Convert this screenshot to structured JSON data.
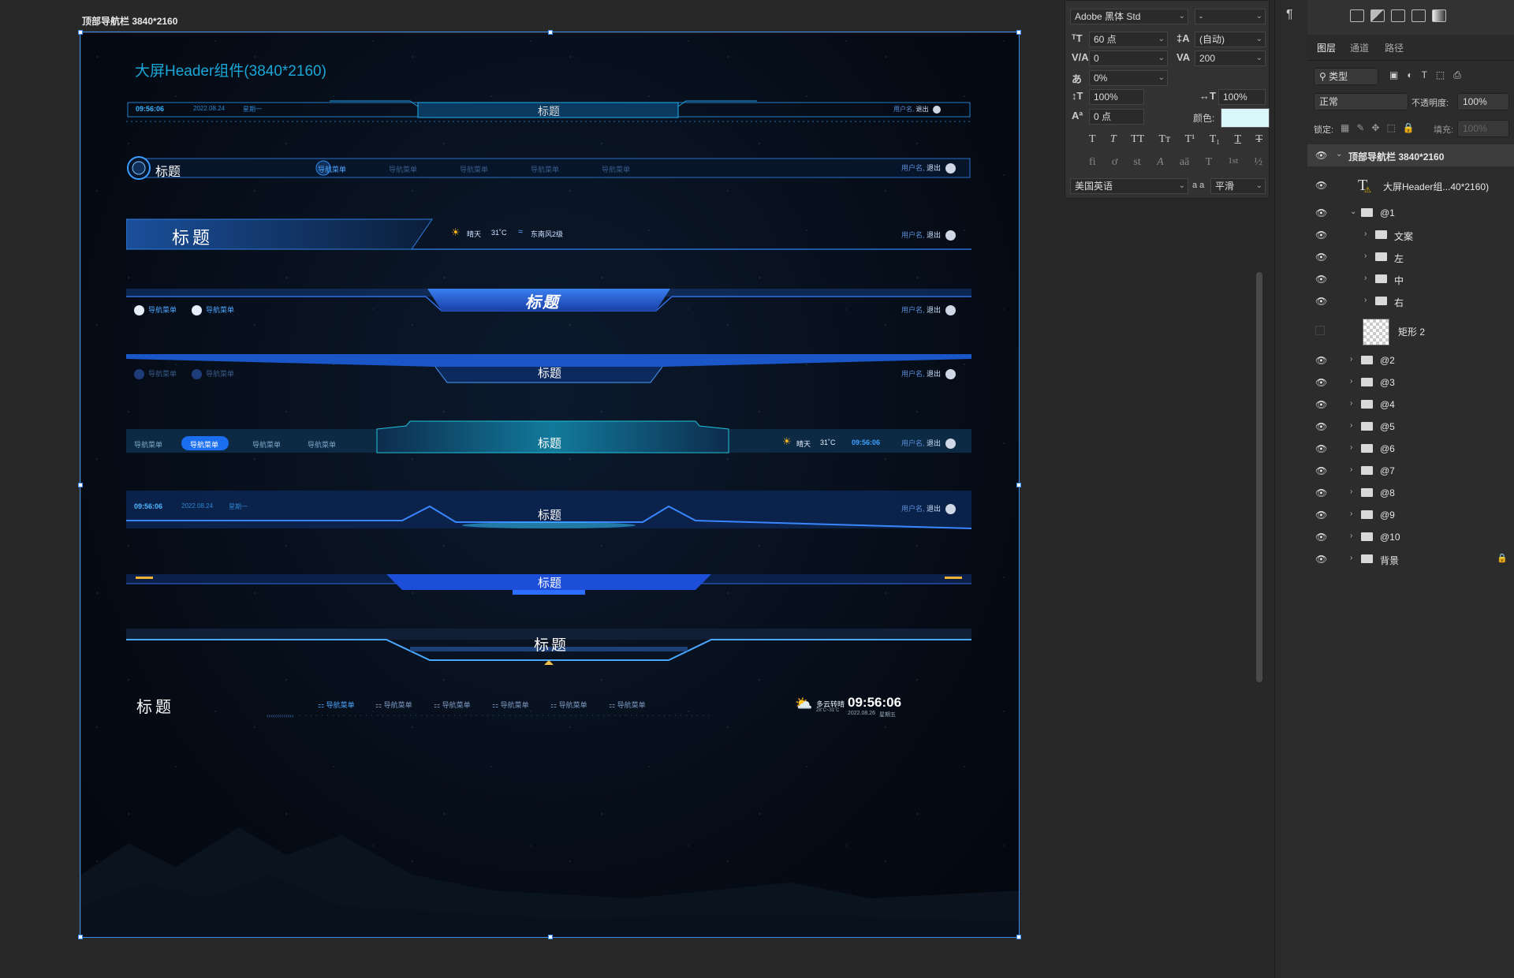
{
  "artboard": {
    "label": "顶部导航栏 3840*2160",
    "heading": "大屏Header组件(3840*2160)"
  },
  "headers": {
    "h1": {
      "time": "09:56:06",
      "date": "2022.08.24",
      "weekday": "星期一",
      "title": "标题",
      "user": "用户名,",
      "logout": "退出"
    },
    "h2": {
      "title": "标题",
      "nav": [
        "导航菜单",
        "导航菜单",
        "导航菜单",
        "导航菜单",
        "导航菜单"
      ],
      "user": "用户名,",
      "logout": "退出"
    },
    "h3": {
      "title": "标题",
      "weather": "晴天",
      "temp": "31˚C",
      "wind": "东南风2级",
      "user": "用户名,",
      "logout": "退出"
    },
    "h4": {
      "title": "标题",
      "nav": [
        "导航菜单",
        "导航菜单"
      ],
      "user": "用户名,",
      "logout": "退出"
    },
    "h5": {
      "title": "标题",
      "nav": [
        "导航菜单",
        "导航菜单"
      ],
      "user": "用户名,",
      "logout": "退出"
    },
    "h6": {
      "title": "标题",
      "nav": [
        "导航菜单",
        "导航菜单",
        "导航菜单",
        "导航菜单"
      ],
      "weather": "晴天",
      "temp": "31˚C",
      "time": "09:56:06",
      "user": "用户名,",
      "logout": "退出"
    },
    "h7": {
      "time": "09:56:06",
      "date": "2022.08.24",
      "weekday": "星期一",
      "title": "标题",
      "user": "用户名,",
      "logout": "退出"
    },
    "h8": {
      "title": "标题"
    },
    "h9": {
      "title": "标题"
    },
    "h10": {
      "title": "标题",
      "nav": [
        "导航菜单",
        "导航菜单",
        "导航菜单",
        "导航菜单",
        "导航菜单",
        "导航菜单"
      ],
      "weather": "多云转晴",
      "temp_range": "28˚C~31˚C",
      "time": "09:56:06",
      "date": "2022.08.26",
      "weekday": "星期五"
    }
  },
  "character_panel": {
    "font_family": "Adobe 黑体 Std",
    "font_style": "-",
    "font_size": "60 点",
    "leading": "(自动)",
    "kerning": "0",
    "tracking": "200",
    "tsume": "0%",
    "vscale": "100%",
    "hscale": "100%",
    "baseline": "0 点",
    "color_label": "颜色:",
    "color_value": "#d9f7fb",
    "language": "美国英语",
    "aa_label": "a a",
    "antialias": "平滑",
    "style_buttons": [
      "T",
      "T",
      "TT",
      "Tт",
      "T¹",
      "T₁",
      "T",
      "T"
    ],
    "opentype_buttons": [
      "fi",
      "ơ",
      "st",
      "A",
      "aā",
      "T",
      "1st",
      "½"
    ]
  },
  "layers_panel": {
    "tabs": [
      "图层",
      "通道",
      "路径"
    ],
    "filter": "类型",
    "blend_mode": "正常",
    "opacity_label": "不透明度:",
    "opacity": "100%",
    "lock_label": "锁定:",
    "fill_label": "填充:",
    "fill": "100%",
    "layers": [
      {
        "name": "顶部导航栏 3840*2160",
        "type": "artboard"
      },
      {
        "name": "大屏Header组...40*2160)",
        "type": "text"
      },
      {
        "name": "@1",
        "type": "group"
      },
      {
        "name": "文案",
        "type": "group"
      },
      {
        "name": "左",
        "type": "group"
      },
      {
        "name": "中",
        "type": "group"
      },
      {
        "name": "右",
        "type": "group"
      },
      {
        "name": "矩形 2",
        "type": "shape"
      },
      {
        "name": "@2",
        "type": "group"
      },
      {
        "name": "@3",
        "type": "group"
      },
      {
        "name": "@4",
        "type": "group"
      },
      {
        "name": "@5",
        "type": "group"
      },
      {
        "name": "@6",
        "type": "group"
      },
      {
        "name": "@7",
        "type": "group"
      },
      {
        "name": "@8",
        "type": "group"
      },
      {
        "name": "@9",
        "type": "group"
      },
      {
        "name": "@10",
        "type": "group"
      },
      {
        "name": "背景",
        "type": "group"
      }
    ]
  }
}
